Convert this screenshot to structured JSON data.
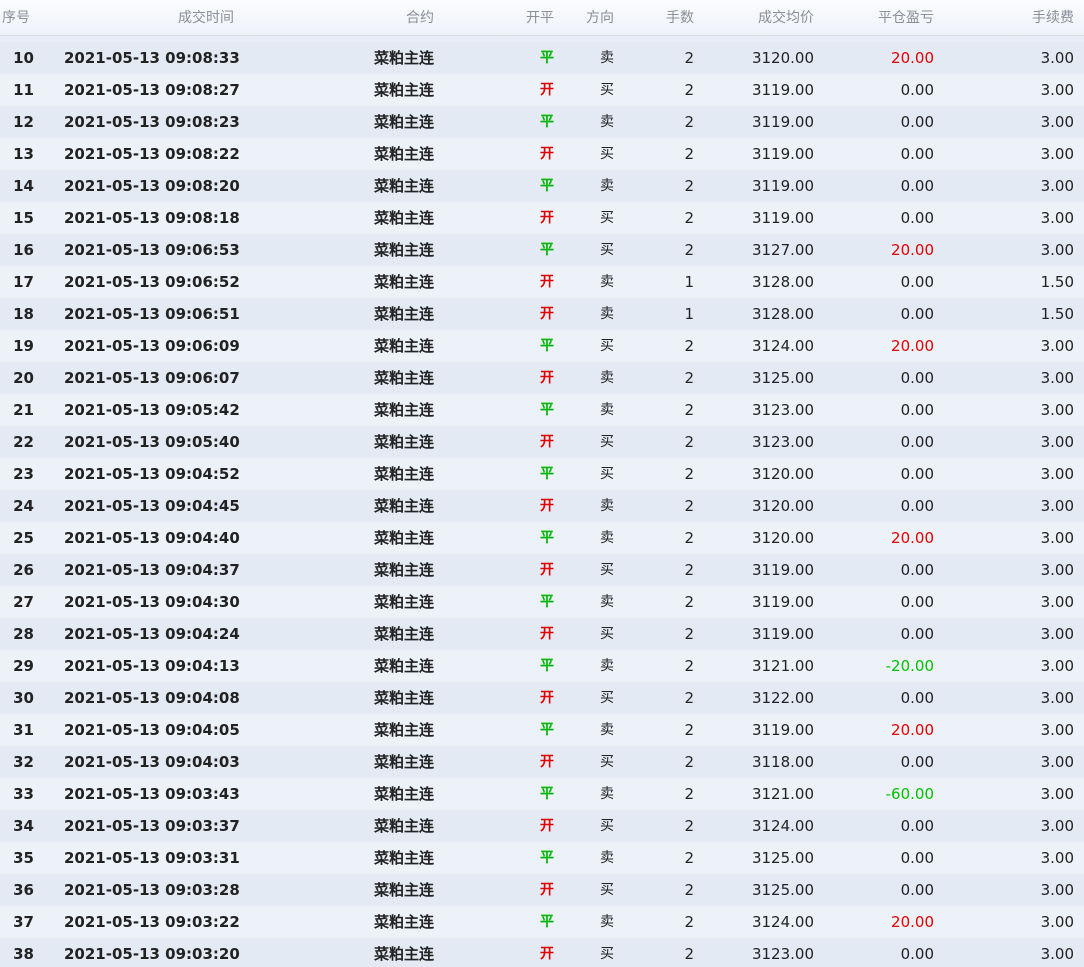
{
  "headers": {
    "seq": "序号",
    "time": "成交时间",
    "contract": "合约",
    "open_close": "开平",
    "direction": "方向",
    "qty": "手数",
    "avg_price": "成交均价",
    "close_pnl": "平仓盈亏",
    "fee": "手续费"
  },
  "colors": {
    "open": "#e00000",
    "close": "#00b400",
    "profit": "#e00000",
    "loss": "#00c000"
  },
  "rows": [
    {
      "seq": "10",
      "time": "2021-05-13 09:08:33",
      "contract": "菜粕主连",
      "oc": "平",
      "dir": "卖",
      "qty": "2",
      "price": "3120.00",
      "pnl": "20.00",
      "fee": "3.00"
    },
    {
      "seq": "11",
      "time": "2021-05-13 09:08:27",
      "contract": "菜粕主连",
      "oc": "开",
      "dir": "买",
      "qty": "2",
      "price": "3119.00",
      "pnl": "0.00",
      "fee": "3.00"
    },
    {
      "seq": "12",
      "time": "2021-05-13 09:08:23",
      "contract": "菜粕主连",
      "oc": "平",
      "dir": "卖",
      "qty": "2",
      "price": "3119.00",
      "pnl": "0.00",
      "fee": "3.00"
    },
    {
      "seq": "13",
      "time": "2021-05-13 09:08:22",
      "contract": "菜粕主连",
      "oc": "开",
      "dir": "买",
      "qty": "2",
      "price": "3119.00",
      "pnl": "0.00",
      "fee": "3.00"
    },
    {
      "seq": "14",
      "time": "2021-05-13 09:08:20",
      "contract": "菜粕主连",
      "oc": "平",
      "dir": "卖",
      "qty": "2",
      "price": "3119.00",
      "pnl": "0.00",
      "fee": "3.00"
    },
    {
      "seq": "15",
      "time": "2021-05-13 09:08:18",
      "contract": "菜粕主连",
      "oc": "开",
      "dir": "买",
      "qty": "2",
      "price": "3119.00",
      "pnl": "0.00",
      "fee": "3.00"
    },
    {
      "seq": "16",
      "time": "2021-05-13 09:06:53",
      "contract": "菜粕主连",
      "oc": "平",
      "dir": "买",
      "qty": "2",
      "price": "3127.00",
      "pnl": "20.00",
      "fee": "3.00"
    },
    {
      "seq": "17",
      "time": "2021-05-13 09:06:52",
      "contract": "菜粕主连",
      "oc": "开",
      "dir": "卖",
      "qty": "1",
      "price": "3128.00",
      "pnl": "0.00",
      "fee": "1.50"
    },
    {
      "seq": "18",
      "time": "2021-05-13 09:06:51",
      "contract": "菜粕主连",
      "oc": "开",
      "dir": "卖",
      "qty": "1",
      "price": "3128.00",
      "pnl": "0.00",
      "fee": "1.50"
    },
    {
      "seq": "19",
      "time": "2021-05-13 09:06:09",
      "contract": "菜粕主连",
      "oc": "平",
      "dir": "买",
      "qty": "2",
      "price": "3124.00",
      "pnl": "20.00",
      "fee": "3.00"
    },
    {
      "seq": "20",
      "time": "2021-05-13 09:06:07",
      "contract": "菜粕主连",
      "oc": "开",
      "dir": "卖",
      "qty": "2",
      "price": "3125.00",
      "pnl": "0.00",
      "fee": "3.00"
    },
    {
      "seq": "21",
      "time": "2021-05-13 09:05:42",
      "contract": "菜粕主连",
      "oc": "平",
      "dir": "卖",
      "qty": "2",
      "price": "3123.00",
      "pnl": "0.00",
      "fee": "3.00"
    },
    {
      "seq": "22",
      "time": "2021-05-13 09:05:40",
      "contract": "菜粕主连",
      "oc": "开",
      "dir": "买",
      "qty": "2",
      "price": "3123.00",
      "pnl": "0.00",
      "fee": "3.00"
    },
    {
      "seq": "23",
      "time": "2021-05-13 09:04:52",
      "contract": "菜粕主连",
      "oc": "平",
      "dir": "买",
      "qty": "2",
      "price": "3120.00",
      "pnl": "0.00",
      "fee": "3.00"
    },
    {
      "seq": "24",
      "time": "2021-05-13 09:04:45",
      "contract": "菜粕主连",
      "oc": "开",
      "dir": "卖",
      "qty": "2",
      "price": "3120.00",
      "pnl": "0.00",
      "fee": "3.00"
    },
    {
      "seq": "25",
      "time": "2021-05-13 09:04:40",
      "contract": "菜粕主连",
      "oc": "平",
      "dir": "卖",
      "qty": "2",
      "price": "3120.00",
      "pnl": "20.00",
      "fee": "3.00"
    },
    {
      "seq": "26",
      "time": "2021-05-13 09:04:37",
      "contract": "菜粕主连",
      "oc": "开",
      "dir": "买",
      "qty": "2",
      "price": "3119.00",
      "pnl": "0.00",
      "fee": "3.00"
    },
    {
      "seq": "27",
      "time": "2021-05-13 09:04:30",
      "contract": "菜粕主连",
      "oc": "平",
      "dir": "卖",
      "qty": "2",
      "price": "3119.00",
      "pnl": "0.00",
      "fee": "3.00"
    },
    {
      "seq": "28",
      "time": "2021-05-13 09:04:24",
      "contract": "菜粕主连",
      "oc": "开",
      "dir": "买",
      "qty": "2",
      "price": "3119.00",
      "pnl": "0.00",
      "fee": "3.00"
    },
    {
      "seq": "29",
      "time": "2021-05-13 09:04:13",
      "contract": "菜粕主连",
      "oc": "平",
      "dir": "卖",
      "qty": "2",
      "price": "3121.00",
      "pnl": "-20.00",
      "fee": "3.00"
    },
    {
      "seq": "30",
      "time": "2021-05-13 09:04:08",
      "contract": "菜粕主连",
      "oc": "开",
      "dir": "买",
      "qty": "2",
      "price": "3122.00",
      "pnl": "0.00",
      "fee": "3.00"
    },
    {
      "seq": "31",
      "time": "2021-05-13 09:04:05",
      "contract": "菜粕主连",
      "oc": "平",
      "dir": "卖",
      "qty": "2",
      "price": "3119.00",
      "pnl": "20.00",
      "fee": "3.00"
    },
    {
      "seq": "32",
      "time": "2021-05-13 09:04:03",
      "contract": "菜粕主连",
      "oc": "开",
      "dir": "买",
      "qty": "2",
      "price": "3118.00",
      "pnl": "0.00",
      "fee": "3.00"
    },
    {
      "seq": "33",
      "time": "2021-05-13 09:03:43",
      "contract": "菜粕主连",
      "oc": "平",
      "dir": "卖",
      "qty": "2",
      "price": "3121.00",
      "pnl": "-60.00",
      "fee": "3.00"
    },
    {
      "seq": "34",
      "time": "2021-05-13 09:03:37",
      "contract": "菜粕主连",
      "oc": "开",
      "dir": "买",
      "qty": "2",
      "price": "3124.00",
      "pnl": "0.00",
      "fee": "3.00"
    },
    {
      "seq": "35",
      "time": "2021-05-13 09:03:31",
      "contract": "菜粕主连",
      "oc": "平",
      "dir": "卖",
      "qty": "2",
      "price": "3125.00",
      "pnl": "0.00",
      "fee": "3.00"
    },
    {
      "seq": "36",
      "time": "2021-05-13 09:03:28",
      "contract": "菜粕主连",
      "oc": "开",
      "dir": "买",
      "qty": "2",
      "price": "3125.00",
      "pnl": "0.00",
      "fee": "3.00"
    },
    {
      "seq": "37",
      "time": "2021-05-13 09:03:22",
      "contract": "菜粕主连",
      "oc": "平",
      "dir": "卖",
      "qty": "2",
      "price": "3124.00",
      "pnl": "20.00",
      "fee": "3.00"
    },
    {
      "seq": "38",
      "time": "2021-05-13 09:03:20",
      "contract": "菜粕主连",
      "oc": "开",
      "dir": "买",
      "qty": "2",
      "price": "3123.00",
      "pnl": "0.00",
      "fee": "3.00"
    }
  ]
}
